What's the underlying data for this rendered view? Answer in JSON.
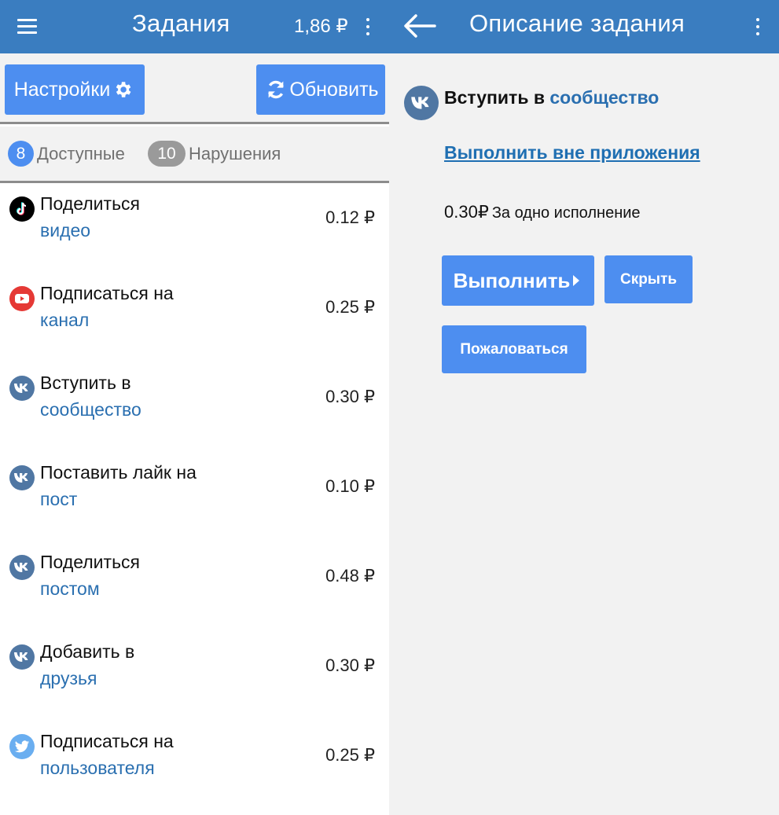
{
  "header": {
    "title": "Задания",
    "balance": "1,86 ₽",
    "detail_title": "Описание задания"
  },
  "toolbar": {
    "settings_label": "Настройки",
    "refresh_label": "Обновить"
  },
  "tabs": [
    {
      "count": "8",
      "label": "Доступные"
    },
    {
      "count": "10",
      "label": "Нарушения"
    }
  ],
  "tasks": [
    {
      "icon": "tiktok-icon",
      "line1": "Поделиться",
      "line2": "видео",
      "price": "0.12 ₽"
    },
    {
      "icon": "youtube-icon",
      "line1": "Подписаться на",
      "line2": "канал",
      "price": "0.25 ₽"
    },
    {
      "icon": "vk-icon",
      "line1": "Вступить в",
      "line2": "сообщество",
      "price": "0.30 ₽"
    },
    {
      "icon": "vk-icon",
      "line1": "Поставить лайк на",
      "line2": "пост",
      "price": "0.10 ₽"
    },
    {
      "icon": "vk-icon",
      "line1": "Поделиться",
      "line2": "постом",
      "price": "0.48 ₽"
    },
    {
      "icon": "vk-icon",
      "line1": "Добавить в",
      "line2": "друзья",
      "price": "0.30 ₽"
    },
    {
      "icon": "twitter-icon",
      "line1": "Подписаться на",
      "line2": "пользователя",
      "price": "0.25 ₽"
    }
  ],
  "detail": {
    "icon": "vk-icon",
    "title_prefix": "Вступить в ",
    "title_highlight": "сообщество",
    "external_link": "Выполнить вне приложения",
    "price": "0.30₽",
    "price_note": "За одно исполнение",
    "run_label": "Выполнить",
    "hide_label": "Скрыть",
    "report_label": "Пожаловаться"
  },
  "colors": {
    "header": "#3a7dc0",
    "button": "#4d8ef0",
    "link": "#2a6fb0",
    "vk": "#5077a3",
    "youtube": "#e53935",
    "twitter": "#6aaef0",
    "tiktok": "#000000"
  }
}
